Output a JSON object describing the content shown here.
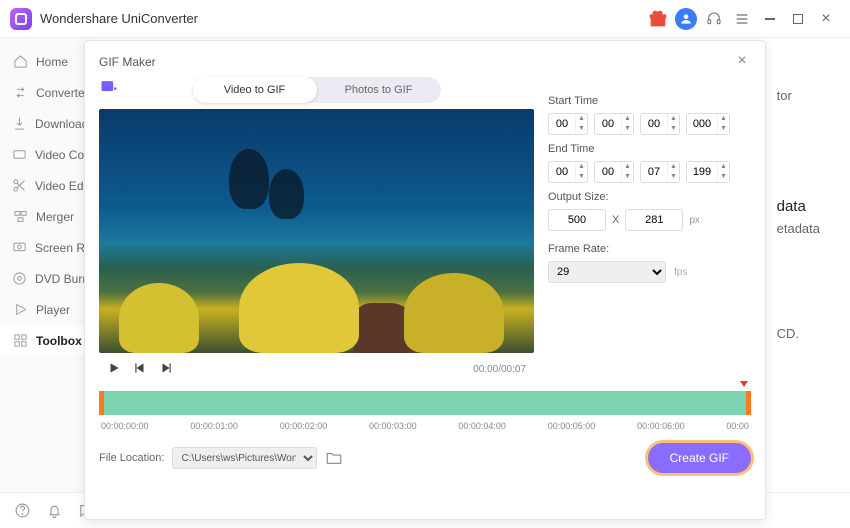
{
  "app": {
    "title": "Wondershare UniConverter"
  },
  "sidebar": {
    "items": [
      {
        "label": "Home"
      },
      {
        "label": "Converter"
      },
      {
        "label": "Downloader"
      },
      {
        "label": "Video Compressor"
      },
      {
        "label": "Video Editor"
      },
      {
        "label": "Merger"
      },
      {
        "label": "Screen Recorder"
      },
      {
        "label": "DVD Burner"
      },
      {
        "label": "Player"
      },
      {
        "label": "Toolbox"
      }
    ]
  },
  "background": {
    "heading": "data",
    "line1": "etadata",
    "line2": "CD.",
    "tor": "tor"
  },
  "modal": {
    "title": "GIF Maker",
    "tabs": {
      "video": "Video to GIF",
      "photos": "Photos to GIF"
    },
    "time_display": "00:00/00:07",
    "start_label": "Start Time",
    "end_label": "End Time",
    "start": {
      "h": "00",
      "m": "00",
      "s": "00",
      "ms": "000"
    },
    "end": {
      "h": "00",
      "m": "00",
      "s": "07",
      "ms": "199"
    },
    "output_label": "Output Size:",
    "out_w": "500",
    "x_label": "X",
    "out_h": "281",
    "px": "px",
    "fr_label": "Frame Rate:",
    "fr_value": "29",
    "fps": "fps",
    "ticks": [
      "00:00:00:00",
      "00:00:01:00",
      "00:00:02:00",
      "00:00:03:00",
      "00:00:04:00",
      "00:00:05:00",
      "00:00:06:00",
      "00:00"
    ],
    "file_loc_label": "File Location:",
    "file_loc_value": "C:\\Users\\ws\\Pictures\\Wonders",
    "create": "Create GIF"
  }
}
